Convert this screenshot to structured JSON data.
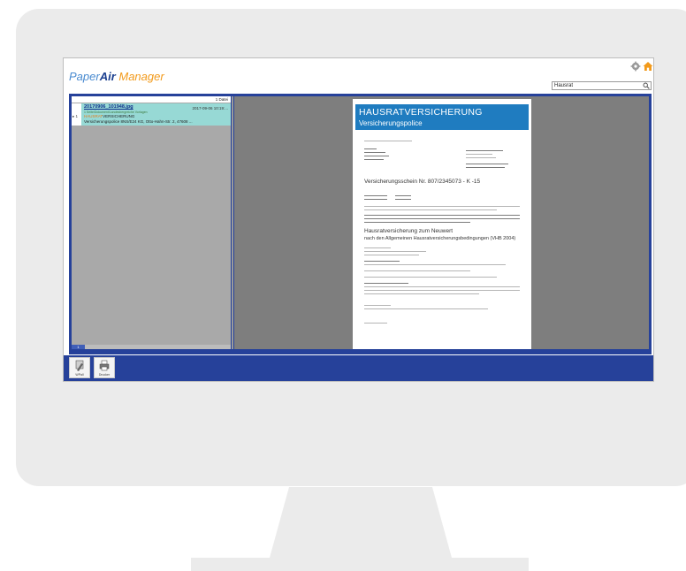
{
  "app": {
    "logo": {
      "paper": "Paper",
      "air": "Air",
      "manager": " Manager"
    },
    "colors": {
      "accent": "#26419a",
      "logo_blue": "#4a8bd0",
      "logo_orange": "#f29a1b",
      "selected_row": "#97d9d5"
    }
  },
  "header": {
    "icons": [
      "gear-icon",
      "home-icon"
    ],
    "search": {
      "value": "Hausrat"
    }
  },
  "document_list": {
    "count_label": "1 Datei",
    "items": [
      {
        "marker": "▸ 1",
        "filename": "20170906_101948.jpg",
        "date": "2017-09-06 10:19:...",
        "meta": "1 Seite/Dokument/Landesbergreiche Vorlagen",
        "tag_highlight": "HAUSRAT",
        "tag_rest": "VERSICHERUNG",
        "description": "Versicherungspolice 8NS/E24 KG, Otto-Hahn-Str. 2, 47608 ..."
      }
    ],
    "pager": {
      "page": "1"
    }
  },
  "preview": {
    "banner_title": "HAUSRATVERSICHERUNG",
    "banner_subtitle": "Versicherungspolice",
    "heading_policy": "Versicherungsschein Nr. 807/2345073 - K -15",
    "heading_section": "Hausratversicherung zum Neuwert",
    "heading_section_sub": "nach den Allgemeinen Hausratversicherungsbedingungen (VHB 2004)"
  },
  "footer": {
    "buttons": [
      {
        "icon": "brush-icon",
        "label": "WPall"
      },
      {
        "icon": "printer-icon",
        "label": "Drucker"
      }
    ]
  }
}
